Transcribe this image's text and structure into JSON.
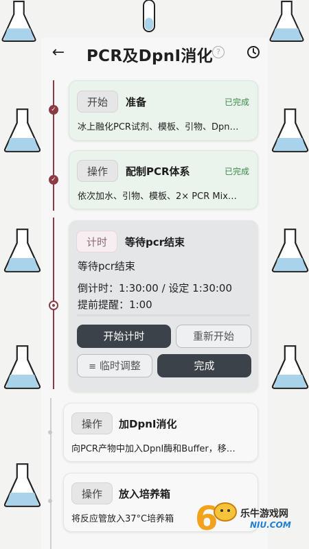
{
  "header": {
    "back_icon": "arrow-left-icon",
    "title": "PCR及DpnI消化",
    "help_icon": "question-circle-icon",
    "help_glyph": "?",
    "history_icon": "history-clock-icon"
  },
  "steps": [
    {
      "tag": "开始",
      "title": "准备",
      "status": "已完成",
      "desc": "冰上融化PCR试剂、模板、引物、Dpn…",
      "state": "done"
    },
    {
      "tag": "操作",
      "title": "配制PCR体系",
      "status": "已完成",
      "desc": "依次加水、引物、模板、2× PCR Mix…",
      "state": "done"
    },
    {
      "tag": "计时",
      "title": "等待pcr结束",
      "state": "active",
      "body_text": "等待pcr结束",
      "countdown": "倒计时：1:30:00 / 设定 1:30:00",
      "reminder": "提前提醒：1:00",
      "buttons": {
        "start_timer": "开始计时",
        "restart": "重新开始",
        "adjust": "临时调整",
        "complete": "完成"
      }
    },
    {
      "tag": "操作",
      "title": "加DpnI消化",
      "desc": "向PCR产物中加入DpnI酶和Buffer，移…",
      "state": "pending"
    },
    {
      "tag": "操作",
      "title": "放入培养箱",
      "desc": "将反应管放入37°C培养箱",
      "state": "pending"
    }
  ],
  "watermark": {
    "name": "乐牛游戏网",
    "domain": "NIU.COM",
    "logo_glyph": "6"
  },
  "colors": {
    "timeline_active": "#8c3a43",
    "done_card_bg": "#eaf4ec",
    "done_status": "#3a8a49",
    "dark_button": "#3b4249",
    "page_bg": "#f6f7f6"
  }
}
